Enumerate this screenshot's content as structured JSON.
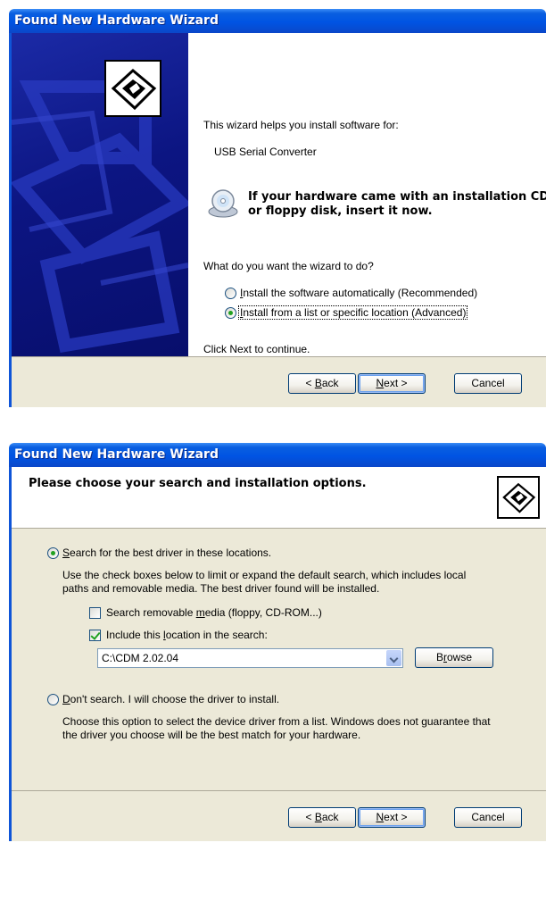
{
  "dialog1": {
    "title": "Found New Hardware Wizard",
    "intro": "This wizard helps you install software for:",
    "device": "USB Serial Converter",
    "cd_notice_line1": "If your hardware came with an installation CD",
    "cd_notice_line2": "or floppy disk, insert it now.",
    "question": "What do you want the wizard to do?",
    "options": [
      {
        "mn": "I",
        "rest": "nstall the software automatically (Recommended)",
        "checked": false
      },
      {
        "mn": "I",
        "rest": "nstall from a list or specific location (Advanced)",
        "checked": true
      }
    ],
    "continue_text": "Click Next to continue.",
    "buttons": {
      "back_prefix": "< ",
      "back_mn": "B",
      "back_rest": "ack",
      "next_mn": "N",
      "next_rest": "ext >",
      "cancel": "Cancel"
    }
  },
  "dialog2": {
    "title": "Found New Hardware Wizard",
    "header": "Please choose your search and installation options.",
    "search_option": {
      "mn": "S",
      "rest": "earch for the best driver in these locations.",
      "checked": true
    },
    "search_desc_line1": "Use the check boxes below to limit or expand the default search, which includes local",
    "search_desc_line2": "paths and removable media. The best driver found will be installed.",
    "checkbox_removable": {
      "pre": "Search removable ",
      "mn": "m",
      "post": "edia (floppy, CD-ROM...)",
      "checked": false
    },
    "checkbox_location": {
      "pre": "Include this ",
      "mn": "l",
      "post": "ocation in the search:",
      "checked": true
    },
    "location_value": "C:\\CDM 2.02.04",
    "browse": {
      "mn": "r",
      "pre": "B",
      "post": "owse"
    },
    "dont_search_option": {
      "mn": "D",
      "rest": "on't search. I will choose the driver to install.",
      "checked": false
    },
    "dont_desc_line1": "Choose this option to select the device driver from a list.  Windows does not guarantee that",
    "dont_desc_line2": "the driver you choose will be the best match for your hardware.",
    "buttons": {
      "back_prefix": "< ",
      "back_mn": "B",
      "back_rest": "ack",
      "next_mn": "N",
      "next_rest": "ext >",
      "cancel": "Cancel"
    }
  },
  "colors": {
    "title_bar": "#0054e3",
    "sidebar": "#0c1582",
    "dialog_bg": "#ece9d8",
    "radio_dot": "#21a121"
  }
}
